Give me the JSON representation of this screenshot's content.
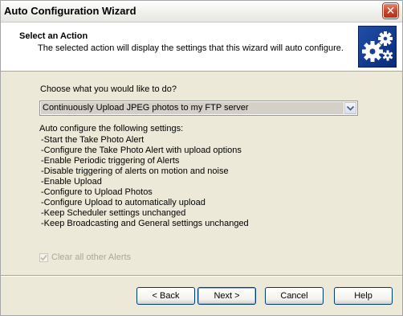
{
  "window": {
    "title": "Auto Configuration Wizard",
    "close_icon": "close-icon"
  },
  "header": {
    "title": "Select an Action",
    "subtitle": "The selected action will display the settings that this wizard will auto configure.",
    "icon": "gears-icon"
  },
  "action": {
    "prompt": "Choose what you would like to do?",
    "selected": "Continuously Upload JPEG photos to my FTP server"
  },
  "settings": {
    "title": "Auto configure the following settings:",
    "items": [
      "-Start the Take Photo Alert",
      "-Configure the Take Photo Alert with upload options",
      "-Enable Periodic triggering of Alerts",
      "-Disable triggering of alerts on motion and noise",
      "-Enable Upload",
      "-Configure to Upload Photos",
      "-Configure Upload to automatically upload",
      "-Keep Scheduler settings unchanged",
      "-Keep Broadcasting and General settings unchanged"
    ]
  },
  "options": {
    "clear_alerts_label": "Clear all other Alerts",
    "clear_alerts_checked": true,
    "clear_alerts_enabled": false
  },
  "buttons": {
    "back": "< Back",
    "next": "Next >",
    "cancel": "Cancel",
    "help": "Help"
  },
  "colors": {
    "dialog_bg": "#ece9d8",
    "close_button": "#c4432a",
    "icon_bg": "#1f4fa8",
    "button_border": "#003c74",
    "disabled_text": "#aca899"
  }
}
